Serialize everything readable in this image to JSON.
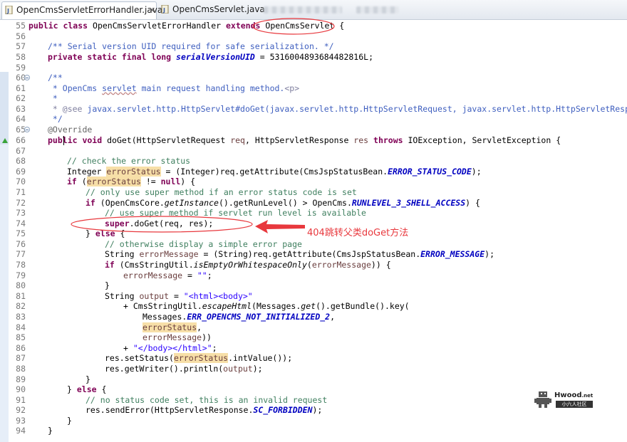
{
  "tabs": [
    {
      "label": "OpenCmsServletErrorHandler.java",
      "active": true
    },
    {
      "label": "OpenCmsServlet.java",
      "active": false
    }
  ],
  "line_numbers": [
    "55",
    "56",
    "57",
    "58",
    "59",
    "60",
    "61",
    "62",
    "63",
    "64",
    "65",
    "66",
    "67",
    "68",
    "69",
    "70",
    "71",
    "72",
    "73",
    "74",
    "75",
    "76",
    "77",
    "78",
    "79",
    "80",
    "81",
    "82",
    "83",
    "84",
    "85",
    "86",
    "87",
    "88",
    "89",
    "90",
    "91",
    "92",
    "93",
    "94"
  ],
  "code": {
    "l55": {
      "kw1": "public class",
      "name": "OpenCmsServletErrorHandler",
      "kw2": "extends",
      "sup": "OpenCmsServlet",
      "brace": "{"
    },
    "l57": "/** Serial version UID required for safe serialization. */",
    "l58": {
      "kw": "private static final long",
      "field": "serialVersionUID",
      "val": "= 5316004893684482816L;"
    },
    "l60": "/**",
    "l61": {
      "pre": " * OpenCms ",
      "ul": "servlet",
      "post": " main request handling method.",
      "tag": "<p>"
    },
    "l62": " *",
    "l63": {
      "tag": " * @see",
      "txt": " javax.servlet.http.HttpServlet#doGet(javax.servlet.http.HttpServletRequest, javax.servlet.http.HttpServletResponse)"
    },
    "l64": " */",
    "l65": "@Override",
    "l66": {
      "kw1": "public void",
      "sig": " doGet(HttpServletRequest ",
      "p1": "req",
      "mid": ", HttpServletResponse ",
      "p2": "res",
      "kw2": "throws",
      "end": " IOException, ServletException {"
    },
    "l68": "// check the error status",
    "l69": {
      "t": "Integer ",
      "v": "errorStatus",
      "m": " = (Integer)req.getAttribute(CmsJspStatusBean.",
      "c": "ERROR_STATUS_CODE",
      "e": ");"
    },
    "l70": {
      "kw": "if",
      "o": " (",
      "v": "errorStatus",
      "e": " != ",
      "n": "null",
      "z": ") {"
    },
    "l71": "// only use super method if an error status code is set",
    "l72": {
      "kw": "if",
      "a": " (OpenCmsCore.",
      "m": "getInstance",
      "b": "().getRunLevel() > OpenCms.",
      "c": "RUNLEVEL_3_SHELL_ACCESS",
      "e": ") {"
    },
    "l73": "// use super method if servlet run level is available",
    "l74": {
      "kw": "super",
      "e": ".doGet(req, res);"
    },
    "l75": {
      "a": "} ",
      "kw": "else",
      "e": " {"
    },
    "l76": "// otherwise display a simple error page",
    "l77": {
      "t": "String ",
      "v": "errorMessage",
      "m": " = (String)req.getAttribute(CmsJspStatusBean.",
      "c": "ERROR_MESSAGE",
      "e": ");"
    },
    "l78": {
      "kw": "if",
      "a": " (CmsStringUtil.",
      "m": "isEmptyOrWhitespaceOnly",
      "b": "(",
      "v": "errorMessage",
      "e": ")) {"
    },
    "l79": {
      "v": "errorMessage",
      "m": " = ",
      "s": "\"\"",
      "e": ";"
    },
    "l80": "}",
    "l81": {
      "t": "String ",
      "v": "output",
      "m": " = ",
      "s": "\"<html><body>\""
    },
    "l82": {
      "a": "+ CmsStringUtil.",
      "m": "escapeHtml",
      "b": "(Messages.",
      "m2": "get",
      "e": "().getBundle().key("
    },
    "l83": {
      "a": "Messages.",
      "c": "ERR_OPENCMS_NOT_INITIALIZED_2",
      "e": ","
    },
    "l84": {
      "v": "errorStatus",
      "e": ","
    },
    "l85": {
      "v": "errorMessage",
      "e": "))"
    },
    "l86": {
      "a": "+ ",
      "s": "\"</body></html>\"",
      "e": ";"
    },
    "l87": {
      "a": "res.setStatus(",
      "v": "errorStatus",
      "e": ".intValue());"
    },
    "l88": {
      "a": "res.getWriter().println(",
      "v": "output",
      "e": ");"
    },
    "l89": "}",
    "l90": {
      "a": "} ",
      "kw": "else",
      "e": " {"
    },
    "l91": "// no status code set, this is an invalid request",
    "l92": {
      "a": "res.sendError(HttpServletResponse.",
      "c": "SC_FORBIDDEN",
      "e": ");"
    },
    "l93": "}",
    "l94": "}"
  },
  "annotation": "404跳转父类doGet方法",
  "watermark": {
    "title": "Hwood",
    "suffix": ".net",
    "sub": "小六人社区"
  },
  "colors": {
    "keyword": "#7f0055",
    "comment": "#3f7f5f",
    "javadoc": "#3f5fbf",
    "string": "#2a00ff",
    "constant": "#0000c0",
    "annotation_red": "#e8383d"
  }
}
